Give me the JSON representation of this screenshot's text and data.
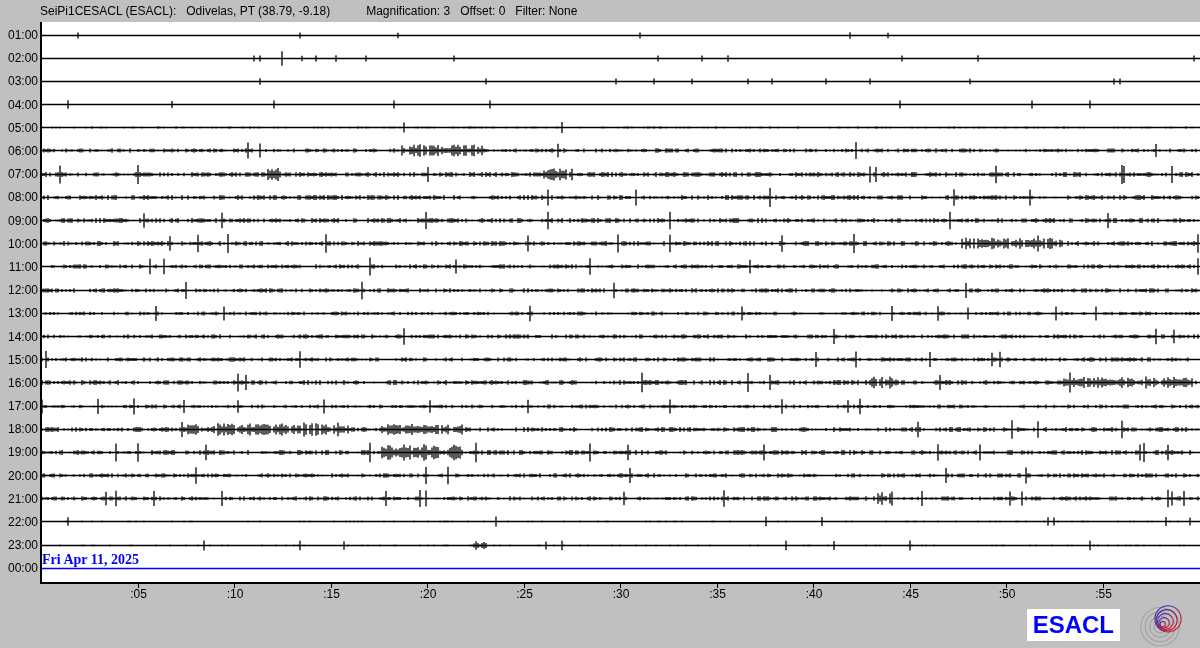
{
  "header": {
    "station": "SeiPi1CESACL (ESACL):",
    "location": "Odivelas, PT (38.79, -9.18)",
    "magnification": "Magnification: 3",
    "offset": "Offset: 0",
    "filter": "Filter: None"
  },
  "rows": [
    {
      "label": "01:00",
      "kind": "trace"
    },
    {
      "label": "02:00",
      "kind": "trace"
    },
    {
      "label": "03:00",
      "kind": "trace"
    },
    {
      "label": "04:00",
      "kind": "trace"
    },
    {
      "label": "05:00",
      "kind": "trace"
    },
    {
      "label": "06:00",
      "kind": "trace"
    },
    {
      "label": "07:00",
      "kind": "trace"
    },
    {
      "label": "08:00",
      "kind": "trace"
    },
    {
      "label": "09:00",
      "kind": "trace"
    },
    {
      "label": "10:00",
      "kind": "trace"
    },
    {
      "label": "11:00",
      "kind": "trace"
    },
    {
      "label": "12:00",
      "kind": "trace"
    },
    {
      "label": "13:00",
      "kind": "trace"
    },
    {
      "label": "14:00",
      "kind": "trace"
    },
    {
      "label": "15:00",
      "kind": "trace"
    },
    {
      "label": "16:00",
      "kind": "trace"
    },
    {
      "label": "17:00",
      "kind": "trace"
    },
    {
      "label": "18:00",
      "kind": "trace"
    },
    {
      "label": "19:00",
      "kind": "trace"
    },
    {
      "label": "20:00",
      "kind": "trace"
    },
    {
      "label": "21:00",
      "kind": "trace"
    },
    {
      "label": "22:00",
      "kind": "trace"
    },
    {
      "label": "23:00",
      "kind": "trace"
    },
    {
      "label": "00:00",
      "kind": "current"
    }
  ],
  "date": "Fri Apr 11, 2025",
  "x_ticks": [
    ":05",
    ":10",
    ":15",
    ":20",
    ":25",
    ":30",
    ":35",
    ":40",
    ":45",
    ":50",
    ":55"
  ],
  "logo": "ESACL"
}
